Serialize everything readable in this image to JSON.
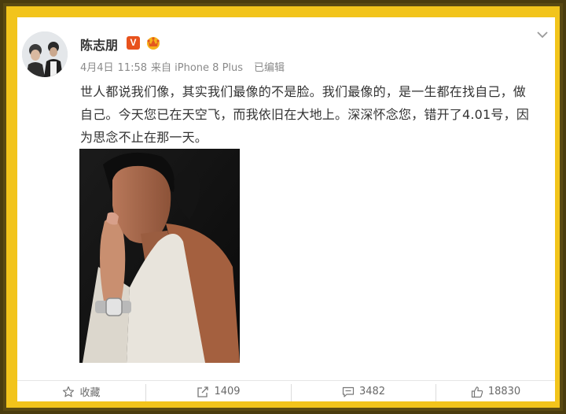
{
  "post": {
    "username": "陈志朋",
    "verified_badge": "V",
    "member_icon": "crown-icon",
    "date": "4月4日",
    "time": "11:58",
    "source": "来自 iPhone 8 Plus",
    "edited": "已编辑",
    "text_lines": [
      "世人都说我们像，其实我们最像的不是脸。我们最像的，是一生都在找自己，做",
      "自己。今天您已在天空飞，而我依旧在大地上。深深怀念您，错开了4.01号，因",
      "为思念不止在那一天。"
    ]
  },
  "actions": {
    "favorite_label": "收藏",
    "repost_count": "1409",
    "comment_count": "3482",
    "like_count": "18830"
  },
  "colors": {
    "frame": "#f2c41b",
    "frame_outer": "#5a4a12",
    "badge": "#e8521c",
    "text": "#333333",
    "meta": "#8a8a8a"
  }
}
